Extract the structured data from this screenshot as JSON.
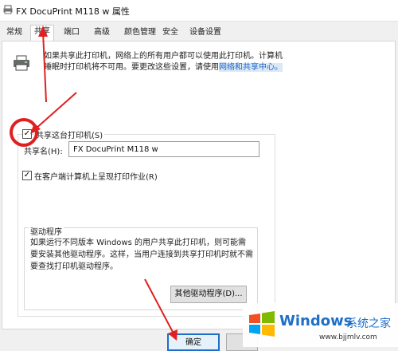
{
  "window": {
    "title": "FX DocuPrint M118 w 属性"
  },
  "tabs": [
    {
      "label": "常规"
    },
    {
      "label": "共享"
    },
    {
      "label": "端口"
    },
    {
      "label": "高级"
    },
    {
      "label": "颜色管理"
    },
    {
      "label": "安全"
    },
    {
      "label": "设备设置"
    }
  ],
  "sharing": {
    "description_main": "如果共享此打印机，网络上的所有用户都可以使用此打印机。计算机睡眠时打印机将不可用。要更改这些设置，请使用",
    "description_link": "网络和共享中心。",
    "share_checkbox_label": "共享这台打印机(S)",
    "share_checked": true,
    "share_name_label": "共享名(H):",
    "share_name_value": "FX DocuPrint M118 w",
    "render_jobs_label": "在客户端计算机上呈现打印作业(R)",
    "render_jobs_checked": true
  },
  "drivers": {
    "group_label": "驱动程序",
    "text": "如果运行不同版本 Windows 的用户共享此打印机，则可能需要安装其他驱动程序。这样，当用户连接到共享打印机时就不需要查找打印机驱动程序。",
    "other_drivers_button": "其他驱动程序(D)..."
  },
  "footer": {
    "ok_button": "确定"
  },
  "watermark": {
    "brand": "Windows",
    "suffix": "系统之家",
    "url": "www.bjjmlv.com"
  },
  "colors": {
    "annotation_red": "#e02020",
    "link_blue": "#1a66c5",
    "windows_blue": "#1e6fc9"
  }
}
